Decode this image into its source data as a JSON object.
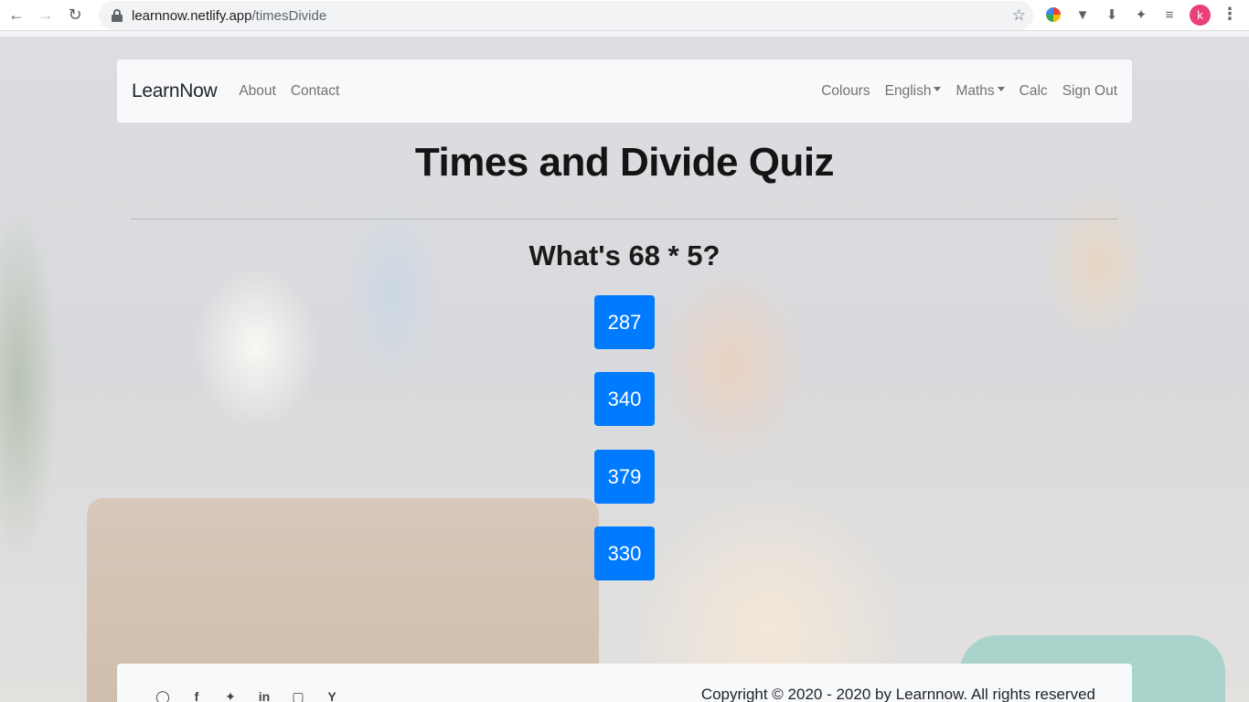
{
  "browser": {
    "url_host": "learnnow.netlify.app",
    "url_path": "/timesDivide",
    "profile_initial": "k"
  },
  "navbar": {
    "brand": "LearnNow",
    "left_links": [
      "About",
      "Contact"
    ],
    "right_links": {
      "colours": "Colours",
      "english": "English",
      "maths": "Maths",
      "calc": "Calc",
      "sign_out": "Sign Out"
    }
  },
  "quiz": {
    "title": "Times and Divide Quiz",
    "question": "What's 68 * 5?",
    "answers": [
      "287",
      "340",
      "379",
      "330"
    ]
  },
  "footer": {
    "social_icons": [
      "github-icon",
      "facebook-icon",
      "twitter-icon",
      "linkedin-icon",
      "instagram-icon",
      "ycombinator-icon"
    ],
    "copyright": "Copyright © 2020 - 2020 by Learnnow. All rights reserved"
  },
  "colors": {
    "answer_button": "#007bff",
    "navbar_bg": "#f8f9fa",
    "profile_avatar": "#e8407a"
  }
}
